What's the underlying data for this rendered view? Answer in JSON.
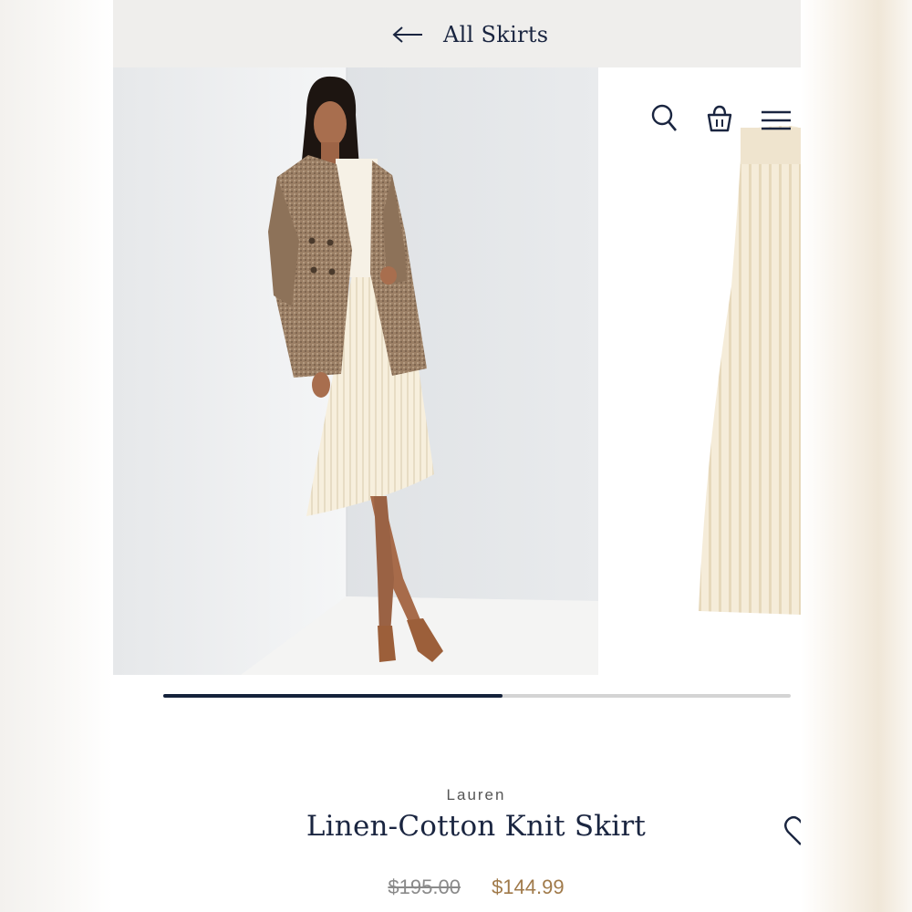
{
  "nav": {
    "back_label": "All Skirts"
  },
  "header_icons": [
    "search-icon",
    "shopping-bag-icon",
    "menu-icon"
  ],
  "gallery": {
    "progress_fraction": 0.54
  },
  "product": {
    "brand": "Lauren",
    "name": "Linen-Cotton Knit Skirt",
    "original_price": "$195.00",
    "sale_price": "$144.99"
  },
  "colors": {
    "navy": "#1a2540",
    "sale": "#a07a4a",
    "topbar": "#efeeec"
  }
}
